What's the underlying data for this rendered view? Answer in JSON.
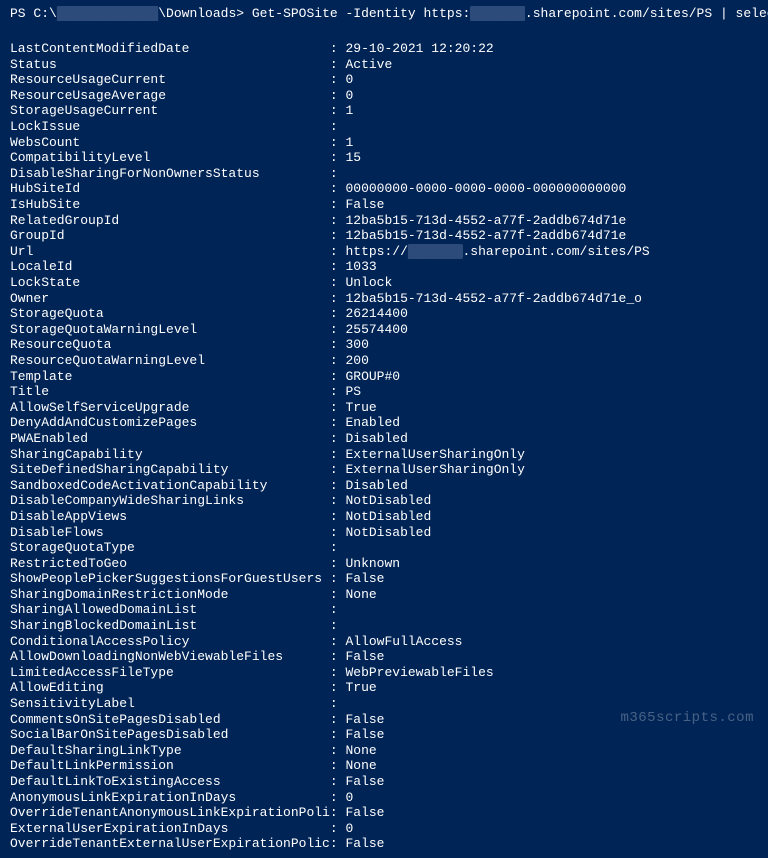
{
  "prompt": {
    "prefix": "PS C:\\",
    "obscured1": "████████ ████",
    "path": "\\Downloads>",
    "cmd_pre": " Get-SPOSite -Identity https:",
    "obscured2": "███████",
    "cmd_post": ".sharepoint.com/sites/PS | select *"
  },
  "url_pre": "https://",
  "url_obs": "██████ ",
  "url_post": ".sharepoint.com/sites/PS",
  "props": [
    {
      "k": "LastContentModifiedDate",
      "v": "29-10-2021 12:20:22"
    },
    {
      "k": "Status",
      "v": "Active"
    },
    {
      "k": "ResourceUsageCurrent",
      "v": "0"
    },
    {
      "k": "ResourceUsageAverage",
      "v": "0"
    },
    {
      "k": "StorageUsageCurrent",
      "v": "1"
    },
    {
      "k": "LockIssue",
      "v": ""
    },
    {
      "k": "WebsCount",
      "v": "1"
    },
    {
      "k": "CompatibilityLevel",
      "v": "15"
    },
    {
      "k": "DisableSharingForNonOwnersStatus",
      "v": ""
    },
    {
      "k": "HubSiteId",
      "v": "00000000-0000-0000-0000-000000000000"
    },
    {
      "k": "IsHubSite",
      "v": "False"
    },
    {
      "k": "RelatedGroupId",
      "v": "12ba5b15-713d-4552-a77f-2addb674d71e"
    },
    {
      "k": "GroupId",
      "v": "12ba5b15-713d-4552-a77f-2addb674d71e"
    },
    {
      "k": "Url",
      "v": "__URL__"
    },
    {
      "k": "LocaleId",
      "v": "1033"
    },
    {
      "k": "LockState",
      "v": "Unlock"
    },
    {
      "k": "Owner",
      "v": "12ba5b15-713d-4552-a77f-2addb674d71e_o"
    },
    {
      "k": "StorageQuota",
      "v": "26214400"
    },
    {
      "k": "StorageQuotaWarningLevel",
      "v": "25574400"
    },
    {
      "k": "ResourceQuota",
      "v": "300"
    },
    {
      "k": "ResourceQuotaWarningLevel",
      "v": "200"
    },
    {
      "k": "Template",
      "v": "GROUP#0"
    },
    {
      "k": "Title",
      "v": "PS"
    },
    {
      "k": "AllowSelfServiceUpgrade",
      "v": "True"
    },
    {
      "k": "DenyAddAndCustomizePages",
      "v": "Enabled"
    },
    {
      "k": "PWAEnabled",
      "v": "Disabled"
    },
    {
      "k": "SharingCapability",
      "v": "ExternalUserSharingOnly"
    },
    {
      "k": "SiteDefinedSharingCapability",
      "v": "ExternalUserSharingOnly"
    },
    {
      "k": "SandboxedCodeActivationCapability",
      "v": "Disabled"
    },
    {
      "k": "DisableCompanyWideSharingLinks",
      "v": "NotDisabled"
    },
    {
      "k": "DisableAppViews",
      "v": "NotDisabled"
    },
    {
      "k": "DisableFlows",
      "v": "NotDisabled"
    },
    {
      "k": "StorageQuotaType",
      "v": ""
    },
    {
      "k": "RestrictedToGeo",
      "v": "Unknown"
    },
    {
      "k": "ShowPeoplePickerSuggestionsForGuestUsers",
      "v": "False"
    },
    {
      "k": "SharingDomainRestrictionMode",
      "v": "None"
    },
    {
      "k": "SharingAllowedDomainList",
      "v": ""
    },
    {
      "k": "SharingBlockedDomainList",
      "v": ""
    },
    {
      "k": "ConditionalAccessPolicy",
      "v": "AllowFullAccess"
    },
    {
      "k": "AllowDownloadingNonWebViewableFiles",
      "v": "False"
    },
    {
      "k": "LimitedAccessFileType",
      "v": "WebPreviewableFiles"
    },
    {
      "k": "AllowEditing",
      "v": "True"
    },
    {
      "k": "SensitivityLabel",
      "v": ""
    },
    {
      "k": "CommentsOnSitePagesDisabled",
      "v": "False"
    },
    {
      "k": "SocialBarOnSitePagesDisabled",
      "v": "False"
    },
    {
      "k": "DefaultSharingLinkType",
      "v": "None"
    },
    {
      "k": "DefaultLinkPermission",
      "v": "None"
    },
    {
      "k": "DefaultLinkToExistingAccess",
      "v": "False"
    },
    {
      "k": "AnonymousLinkExpirationInDays",
      "v": "0"
    },
    {
      "k": "OverrideTenantAnonymousLinkExpirationPolicy",
      "v": "False"
    },
    {
      "k": "ExternalUserExpirationInDays",
      "v": "0"
    },
    {
      "k": "OverrideTenantExternalUserExpirationPolicy",
      "v": "False"
    }
  ],
  "watermark": "m365scripts.com"
}
